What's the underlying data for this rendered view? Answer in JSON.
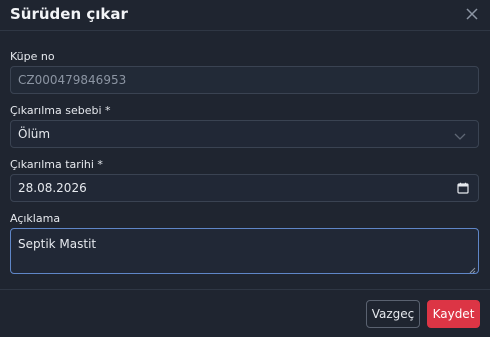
{
  "modal": {
    "title": "Sürüden çıkar",
    "close_icon": "close-icon"
  },
  "form": {
    "ear_tag": {
      "label": "Küpe no",
      "value": "CZ000479846953"
    },
    "reason": {
      "label": "Çıkarılma sebebi *",
      "value": "Ölüm",
      "icon": "chevron-down-icon"
    },
    "date": {
      "label": "Çıkarılma tarihi *",
      "value": "28.08.2026",
      "icon": "calendar-icon"
    },
    "note": {
      "label": "Açıklama",
      "value": "Septik Mastit"
    }
  },
  "footer": {
    "cancel_label": "Vazgeç",
    "save_label": "Kaydet"
  },
  "colors": {
    "background": "#1f2530",
    "input_background": "#212836",
    "input_border": "#3a4352",
    "focus_border": "#5f86c7",
    "danger": "#dc3545"
  }
}
